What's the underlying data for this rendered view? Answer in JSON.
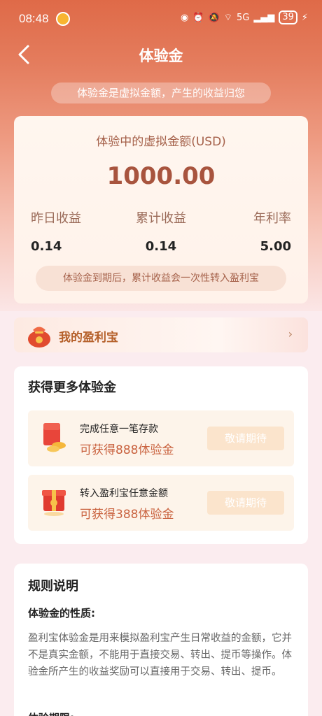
{
  "status_bar": {
    "time": "08:48",
    "network": "5G",
    "battery": "39"
  },
  "nav": {
    "title": "体验金"
  },
  "notice": "体验金是虚拟金额，产生的收益归您",
  "amount_card": {
    "label": "体验中的虚拟金额(USD)",
    "amount": "1000.00",
    "stats": [
      {
        "label": "昨日收益",
        "value": "0.14"
      },
      {
        "label": "累计收益",
        "value": "0.14"
      },
      {
        "label": "年利率",
        "value": "5.00"
      }
    ],
    "note": "体验金到期后，累计收益会一次性转入盈利宝"
  },
  "profit_link": {
    "label": "我的盈利宝",
    "icon": "money-bag-icon"
  },
  "more": {
    "title": "获得更多体验金",
    "tasks": [
      {
        "name": "完成任意一笔存款",
        "reward": "可获得888体验金",
        "button": "敬请期待",
        "icon": "red-envelope-coins-icon"
      },
      {
        "name": "转入盈利宝任意金额",
        "reward": "可获得388体验金",
        "button": "敬请期待",
        "icon": "red-gift-box-icon"
      }
    ]
  },
  "rules": {
    "title": "规则说明",
    "section1_title": "体验金的性质:",
    "section1_text": "盈利宝体验金是用来模拟盈利宝产生日常收益的金额，它并不是真实金额，不能用于直接交易、转出、提币等操作。体验金所产生的收益奖励可以直接用于交易、转出、提币。",
    "section2_title": "体验期限:"
  },
  "colors": {
    "accent": "#df6a48",
    "amount": "#a8543e",
    "reward": "#c9623f"
  }
}
